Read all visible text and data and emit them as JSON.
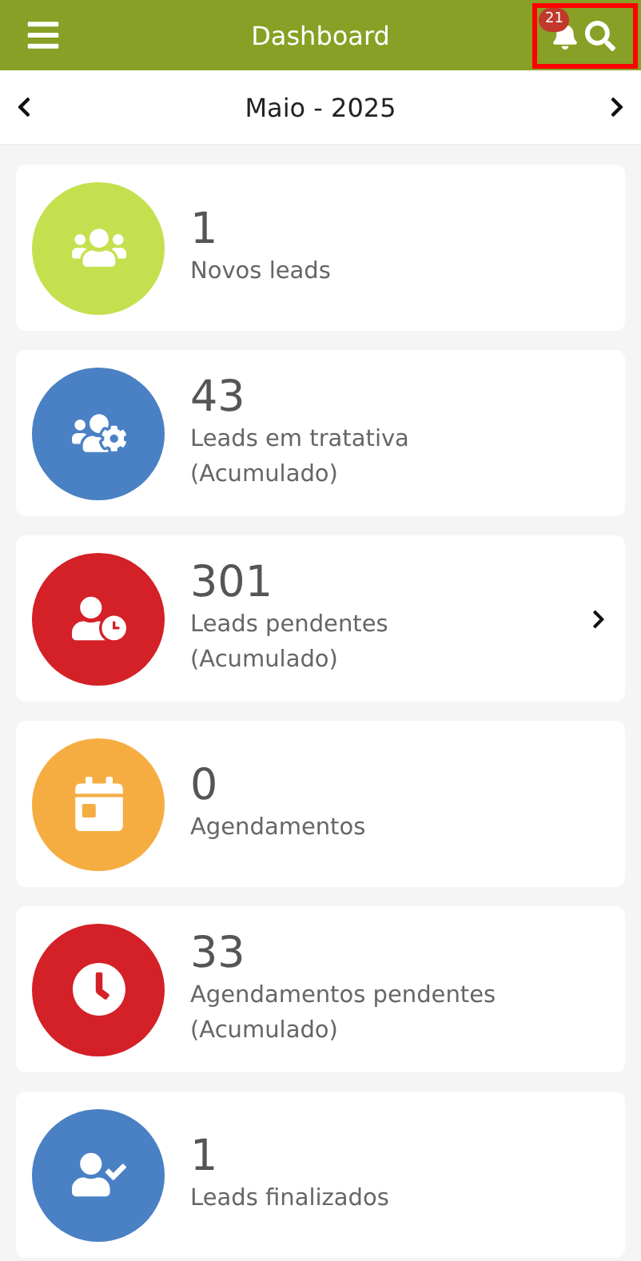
{
  "header": {
    "title": "Dashboard",
    "notifications": {
      "count": "21"
    },
    "highlighted": true
  },
  "month_nav": {
    "label": "Maio - 2025"
  },
  "cards": [
    {
      "value": "1",
      "label": "Novos leads",
      "kind": "group",
      "color": "#c5e04f",
      "chevron": false
    },
    {
      "value": "43",
      "label": "Leads em tratativa",
      "sublabel": "(Acumulado)",
      "kind": "team",
      "color": "#4a80c4",
      "chevron": false
    },
    {
      "value": "301",
      "label": "Leads pendentes",
      "sublabel": "(Acumulado)",
      "kind": "pending",
      "color": "#d42027",
      "chevron": true
    },
    {
      "value": "0",
      "label": "Agendamentos",
      "kind": "schedule",
      "color": "#f5ad42",
      "chevron": false
    },
    {
      "value": "33",
      "label": "Agendamentos pendentes",
      "sublabel": "(Acumulado)",
      "kind": "time",
      "color": "#d42027",
      "chevron": false
    },
    {
      "value": "1",
      "label": "Leads finalizados",
      "kind": "done",
      "color": "#4a80c4",
      "chevron": false
    }
  ]
}
